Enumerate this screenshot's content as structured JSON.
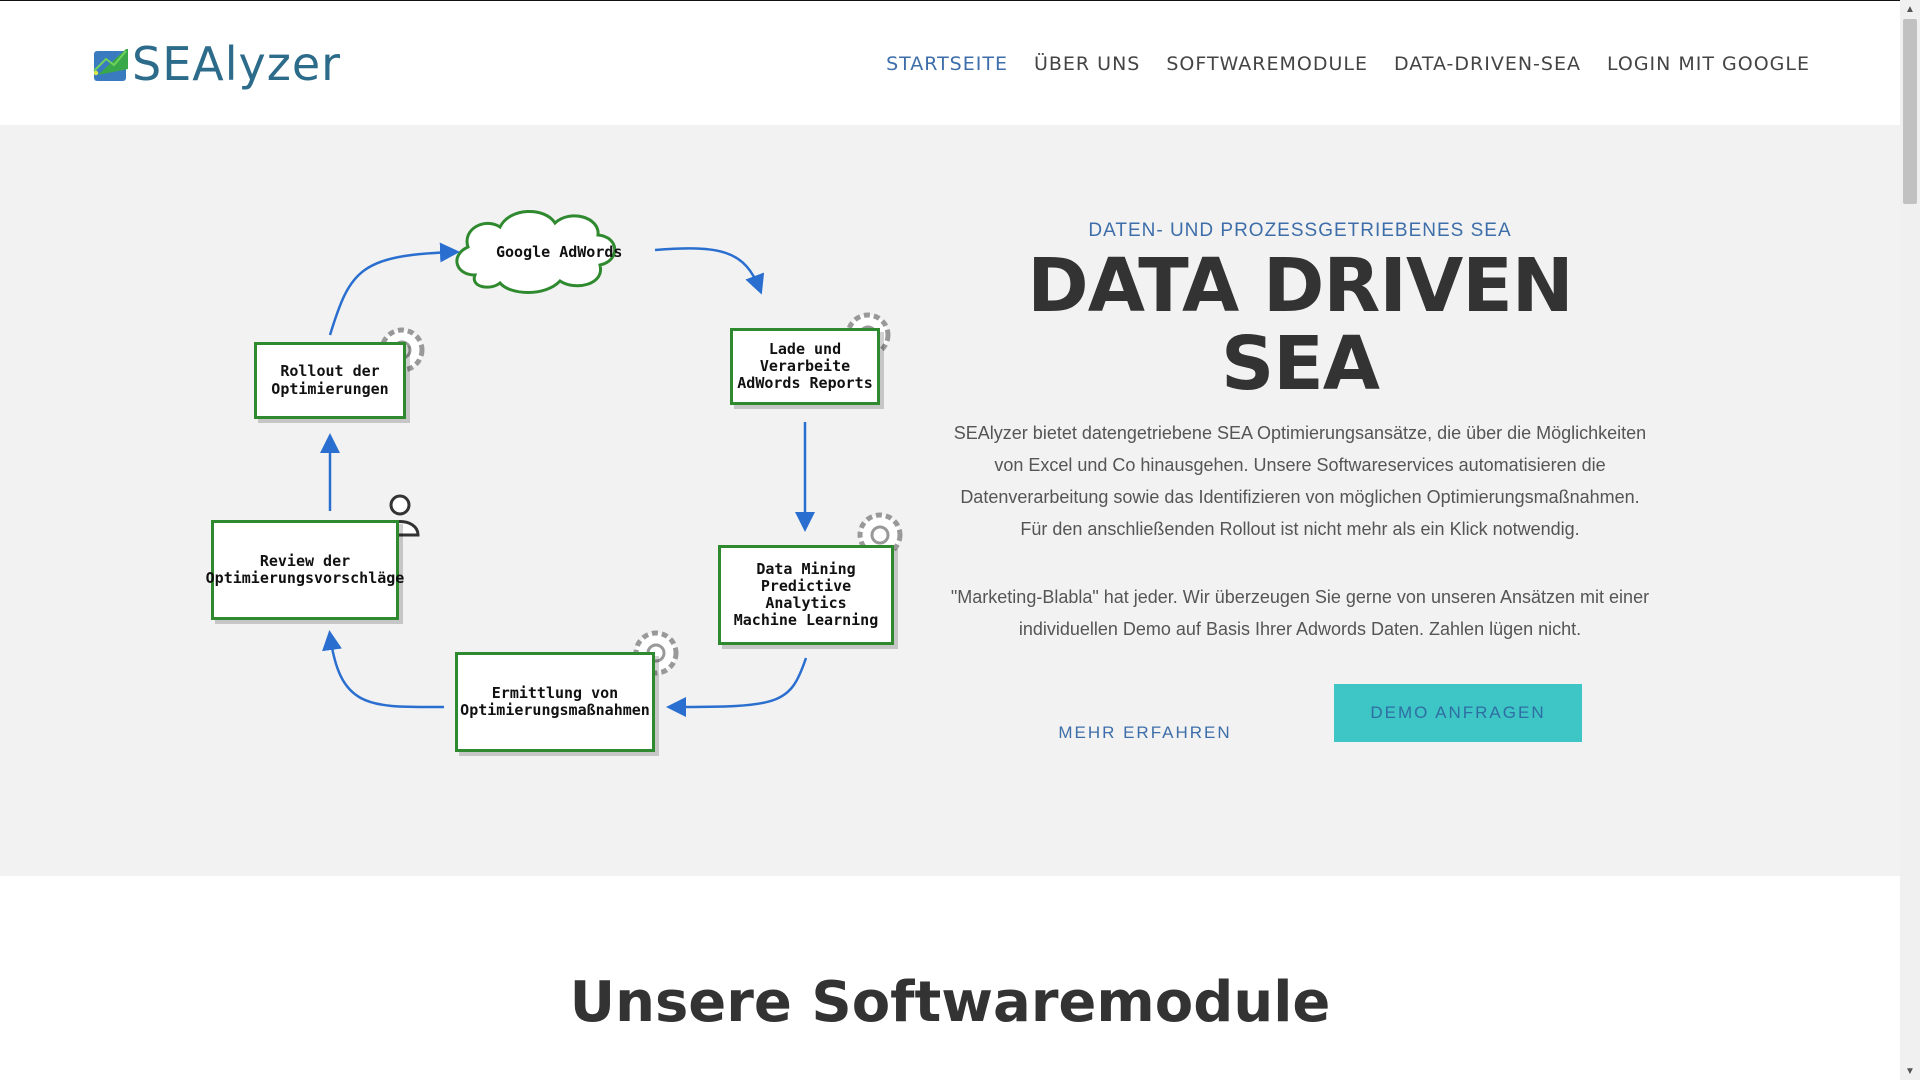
{
  "logo": {
    "text": "SEAlyzer",
    "icon": "sealyzer-logo-mark"
  },
  "nav": {
    "items": [
      {
        "label": "STARTSEITE",
        "active": true
      },
      {
        "label": "ÜBER UNS",
        "active": false
      },
      {
        "label": "SOFTWAREMODULE",
        "active": false
      },
      {
        "label": "DATA-DRIVEN-SEA",
        "active": false
      },
      {
        "label": "LOGIN MIT GOOGLE",
        "active": false
      }
    ]
  },
  "diagram": {
    "cloud": "Google AdWords",
    "boxes": {
      "reports": "Lade und\nVerarbeite\nAdWords Reports",
      "mining": "Data Mining\nPredictive Analytics\nMachine Learning",
      "ermittlung": "Ermittlung von\nOptimierungsmaßnahmen",
      "review": "Review der\nOptimierungsvorschläge",
      "rollout": "Rollout der\nOptimierungen"
    }
  },
  "hero": {
    "kicker": "DATEN- UND PROZESSGETRIEBENES SEA",
    "headline": "DATA DRIVEN SEA",
    "paragraph1": "SEAlyzer bietet datengetriebene SEA Optimierungsansätze, die über die Möglichkeiten von Excel und Co hinausgehen. Unsere Softwareservices automatisieren die Datenverarbeitung sowie das Identifizieren von möglichen Optimierungsmaßnahmen. Für den anschließenden Rollout ist nicht mehr als ein Klick notwendig.",
    "paragraph2": "\"Marketing-Blabla\" hat jeder. Wir überzeugen Sie gerne von unseren Ansätzen mit einer individuellen Demo auf Basis Ihrer Adwords Daten. Zahlen lügen nicht.",
    "more_label": "MEHR ERFAHREN",
    "demo_label": "DEMO ANFRAGEN"
  },
  "section": {
    "title": "Unsere Softwaremodule"
  },
  "colors": {
    "accent": "#3d6ea9",
    "button": "#3ec5c5",
    "hero_bg": "#f2f2f2",
    "box_border": "#2f8a2f",
    "arrow": "#2a6fcf"
  }
}
